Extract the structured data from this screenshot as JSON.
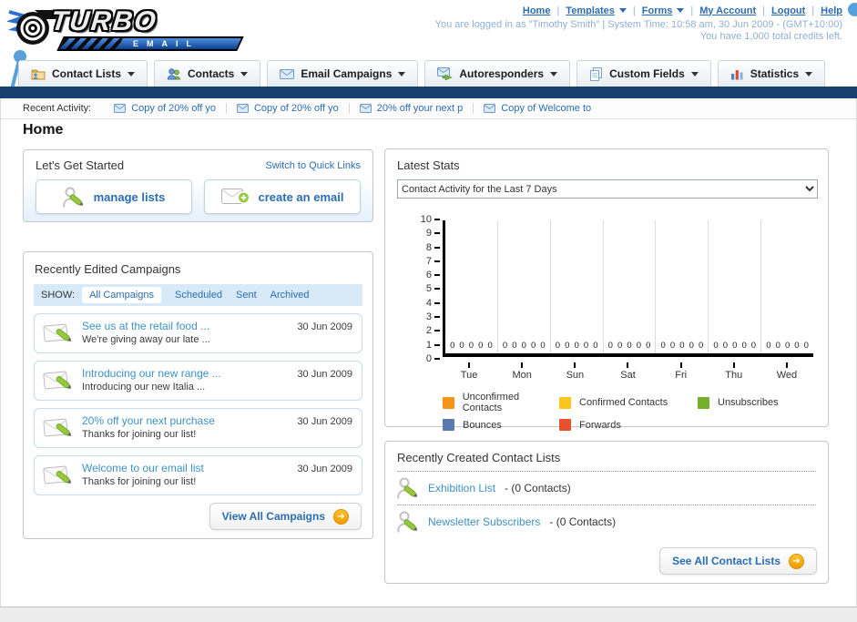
{
  "header": {
    "logo": {
      "title": "TURBO",
      "subtitle": "EMAIL"
    },
    "links": [
      {
        "label": "Home",
        "dropdown": false
      },
      {
        "label": "Templates",
        "dropdown": true
      },
      {
        "label": "Forms",
        "dropdown": true
      },
      {
        "label": "My Account",
        "dropdown": false
      },
      {
        "label": "Logout",
        "dropdown": false
      },
      {
        "label": "Help",
        "dropdown": false
      }
    ],
    "login_line1": "You are logged in as \"Timothy Smith\" | System Time: 10:58 am, 30 Jun 2009 - (GMT+10:00)",
    "login_line2": "You have 1,000 total credits left."
  },
  "nav_tabs": [
    {
      "id": "contact-lists",
      "label": "Contact Lists"
    },
    {
      "id": "contacts",
      "label": "Contacts"
    },
    {
      "id": "email-campaigns",
      "label": "Email Campaigns"
    },
    {
      "id": "autoresponders",
      "label": "Autoresponders"
    },
    {
      "id": "custom-fields",
      "label": "Custom Fields"
    },
    {
      "id": "statistics",
      "label": "Statistics"
    }
  ],
  "recent_activity": {
    "label": "Recent Activity:",
    "items": [
      "Copy of 20% off yo",
      "Copy of 20% off yo",
      "20% off your next p",
      "Copy of Welcome to"
    ]
  },
  "page_title": "Home",
  "get_started": {
    "title": "Let's Get Started",
    "switch_link": "Switch to Quick Links",
    "buttons": [
      {
        "label": "manage lists"
      },
      {
        "label": "create an email"
      }
    ]
  },
  "campaigns": {
    "title": "Recently Edited Campaigns",
    "show_label": "SHOW:",
    "filters": [
      "All Campaigns",
      "Scheduled",
      "Sent",
      "Archived"
    ],
    "active_filter": "All Campaigns",
    "items": [
      {
        "title": "See us at the retail food ...",
        "subtitle": "We're giving away our late ...",
        "date": "30 Jun 2009"
      },
      {
        "title": "Introducing our new range ...",
        "subtitle": "Introducing our new Italia ...",
        "date": "30 Jun 2009"
      },
      {
        "title": "20% off your next purchase",
        "subtitle": "Thanks for joining our list!",
        "date": "30 Jun 2009"
      },
      {
        "title": "Welcome to our email list",
        "subtitle": "Thanks for joining our list!",
        "date": "30 Jun 2009"
      }
    ],
    "view_all_label": "View All Campaigns"
  },
  "stats": {
    "title": "Latest Stats",
    "dropdown_value": "Contact Activity for the Last 7 Days",
    "legend": [
      {
        "label": "Unconfirmed Contacts",
        "color": "#f79418"
      },
      {
        "label": "Confirmed Contacts",
        "color": "#f8c61c"
      },
      {
        "label": "Unsubscribes",
        "color": "#74b029"
      },
      {
        "label": "Bounces",
        "color": "#5b79ad"
      },
      {
        "label": "Forwards",
        "color": "#e8502b"
      }
    ]
  },
  "chart_data": {
    "type": "bar",
    "title": "Contact Activity for the Last 7 Days",
    "categories": [
      "Tue",
      "Mon",
      "Sun",
      "Sat",
      "Fri",
      "Thu",
      "Wed"
    ],
    "series": [
      {
        "name": "Unconfirmed Contacts",
        "color": "#f79418",
        "values": [
          0,
          0,
          0,
          0,
          0,
          0,
          0
        ]
      },
      {
        "name": "Confirmed Contacts",
        "color": "#f8c61c",
        "values": [
          0,
          0,
          0,
          0,
          0,
          0,
          0
        ]
      },
      {
        "name": "Unsubscribes",
        "color": "#74b029",
        "values": [
          0,
          0,
          0,
          0,
          0,
          0,
          0
        ]
      },
      {
        "name": "Bounces",
        "color": "#5b79ad",
        "values": [
          0,
          0,
          0,
          0,
          0,
          0,
          0
        ]
      },
      {
        "name": "Forwards",
        "color": "#e8502b",
        "values": [
          0,
          0,
          0,
          0,
          0,
          0,
          0
        ]
      }
    ],
    "xlabel": "",
    "ylabel": "",
    "ylim": [
      0,
      10
    ],
    "ytick_step": 1,
    "grid": "vertical",
    "legend_position": "bottom"
  },
  "contact_lists": {
    "title": "Recently Created Contact Lists",
    "items": [
      {
        "name": "Exhibition List",
        "detail": "- (0 Contacts)"
      },
      {
        "name": "Newsletter Subscribers",
        "detail": "- (0 Contacts)"
      }
    ],
    "see_all_label": "See All Contact Lists"
  }
}
